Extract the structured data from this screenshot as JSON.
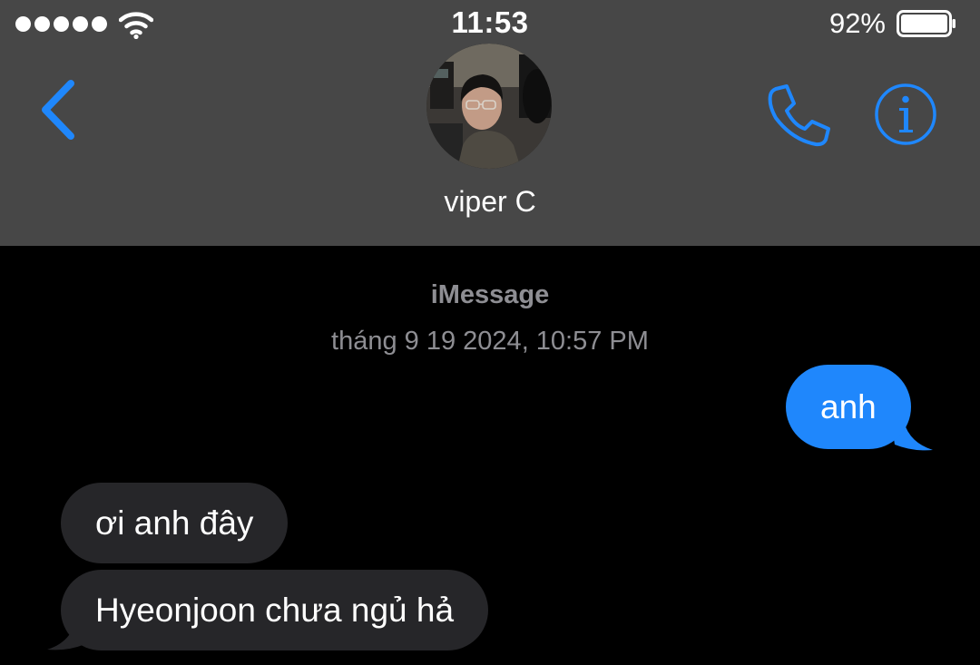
{
  "status_bar": {
    "time": "11:53",
    "battery_percent": "92%",
    "battery_level": 0.92,
    "signal_bars": 5,
    "wifi_icon": "wifi-icon"
  },
  "header": {
    "back_icon": "chevron-left-icon",
    "contact_name": "viper C",
    "call_icon": "phone-icon",
    "info_icon": "info-icon",
    "accent_color": "#1f87fc",
    "background_color": "#474747"
  },
  "conversation": {
    "service_label": "iMessage",
    "timestamp": "tháng 9 19 2024, 10:57 PM",
    "messages": [
      {
        "direction": "outgoing",
        "text": "anh"
      },
      {
        "direction": "incoming",
        "text": "ơi anh đây"
      },
      {
        "direction": "incoming",
        "text": "Hyeonjoon chưa ngủ hả"
      }
    ],
    "outgoing_color": "#1f87fc",
    "incoming_color": "#262629"
  }
}
